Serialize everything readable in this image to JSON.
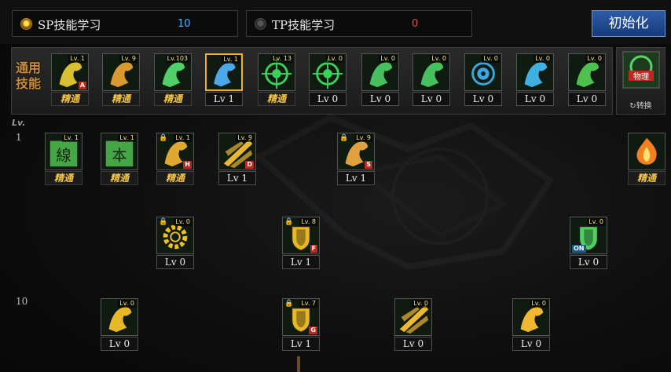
{
  "tabs": {
    "sp": {
      "label": "SP技能学习",
      "value": "10",
      "selected": true
    },
    "tp": {
      "label": "TP技能学习",
      "value": "0",
      "selected": false
    }
  },
  "init_button": "初始化",
  "common": {
    "label": "通用技能",
    "convert_label": "转换",
    "convert_icon_text": "物理",
    "skills": [
      {
        "name": "common-skill-1",
        "icon": "dash-kick-icon",
        "tag": "Lv. 1",
        "hotkey": "A",
        "badge": "精通",
        "badge_type": "master",
        "color": "#d8c030"
      },
      {
        "name": "common-skill-2",
        "icon": "fist-icon",
        "tag": "Lv. 9",
        "hotkey": "",
        "badge": "精通",
        "badge_type": "master",
        "color": "#d89a30"
      },
      {
        "name": "common-skill-3",
        "icon": "leap-icon",
        "tag": "Lv.103",
        "hotkey": "",
        "badge": "精通",
        "badge_type": "master",
        "color": "#4fd06a"
      },
      {
        "name": "common-skill-4",
        "icon": "wings-icon",
        "tag": "Lv. 1",
        "hotkey": "",
        "badge": "Lv 1",
        "badge_type": "lv",
        "color": "#4aa8e8",
        "selected": true
      },
      {
        "name": "common-skill-5",
        "icon": "target-icon",
        "tag": "Lv. 13",
        "hotkey": "",
        "badge": "精通",
        "badge_type": "master",
        "color": "#3ad05a"
      },
      {
        "name": "common-skill-6",
        "icon": "target-icon",
        "tag": "Lv. 0",
        "hotkey": "",
        "badge": "Lv 0",
        "badge_type": "lv",
        "color": "#3ad05a"
      },
      {
        "name": "common-skill-7",
        "icon": "runner-icon",
        "tag": "Lv. 0",
        "hotkey": "",
        "badge": "Lv 0",
        "badge_type": "lv",
        "color": "#49c060"
      },
      {
        "name": "common-skill-8",
        "icon": "runner-icon",
        "tag": "Lv. 0",
        "hotkey": "",
        "badge": "Lv 0",
        "badge_type": "lv",
        "color": "#49c060"
      },
      {
        "name": "common-skill-9",
        "icon": "eye-icon",
        "tag": "Lv. 0",
        "hotkey": "",
        "badge": "Lv 0",
        "badge_type": "lv",
        "color": "#3aa8e0"
      },
      {
        "name": "common-skill-10",
        "icon": "figure-icon",
        "tag": "Lv. 0",
        "hotkey": "",
        "badge": "Lv 0",
        "badge_type": "lv",
        "color": "#40b0e0"
      },
      {
        "name": "common-skill-11",
        "icon": "claw-icon",
        "tag": "Lv. 0",
        "hotkey": "",
        "badge": "Lv 0",
        "badge_type": "lv",
        "color": "#4ec050"
      }
    ]
  },
  "tree": {
    "lv_header": "Lv.",
    "row_labels": [
      "1",
      "10"
    ],
    "skills": [
      {
        "name": "tree-skill-line",
        "icon": "line-scroll-icon",
        "tag": "Lv. 1",
        "lock": "",
        "hotkey": "",
        "badge": "精通",
        "badge_type": "master",
        "color": "#50c050",
        "glyph": "線"
      },
      {
        "name": "tree-skill-base",
        "icon": "base-scroll-icon",
        "tag": "Lv. 1",
        "lock": "",
        "hotkey": "",
        "badge": "精通",
        "badge_type": "master",
        "color": "#50c050",
        "glyph": "本"
      },
      {
        "name": "tree-skill-swing",
        "icon": "swing-icon",
        "tag": "Lv. 1",
        "lock": "🔒",
        "hotkey": "H",
        "badge": "精通",
        "badge_type": "master",
        "color": "#e0a830"
      },
      {
        "name": "tree-skill-slash",
        "icon": "slash-icon",
        "tag": "Lv. 9",
        "lock": "",
        "hotkey": "D",
        "badge": "Lv 1",
        "badge_type": "lv",
        "color": "#e8b830"
      },
      {
        "name": "tree-skill-kick",
        "icon": "kick-icon",
        "tag": "Lv. 9",
        "lock": "🔒",
        "hotkey": "S",
        "badge": "Lv 1",
        "badge_type": "lv",
        "color": "#e0a040"
      },
      {
        "name": "tree-skill-flame",
        "icon": "flame-icon",
        "tag": "",
        "lock": "",
        "hotkey": "",
        "badge": "精通",
        "badge_type": "master",
        "color": "#f08020"
      },
      {
        "name": "tree-skill-gear",
        "icon": "gear-icon",
        "tag": "Lv. 0",
        "lock": "🔒",
        "hotkey": "",
        "badge": "Lv 0",
        "badge_type": "lv",
        "color": "#f0c020"
      },
      {
        "name": "tree-skill-shield-strike",
        "icon": "shield-strike-icon",
        "tag": "Lv. 8",
        "lock": "🔒",
        "hotkey": "F",
        "badge": "Lv 1",
        "badge_type": "lv",
        "color": "#e8b828"
      },
      {
        "name": "tree-skill-barrier",
        "icon": "barrier-icon",
        "tag": "Lv. 0",
        "lock": "",
        "hotkey": "",
        "badge": "Lv 0",
        "badge_type": "lv",
        "color": "#50d060",
        "on_tag": "ON"
      },
      {
        "name": "tree-skill-wing-burst",
        "icon": "wing-burst-icon",
        "tag": "Lv. 0",
        "lock": "",
        "hotkey": "",
        "badge": "Lv 0",
        "badge_type": "lv",
        "color": "#e8b828"
      },
      {
        "name": "tree-skill-guard",
        "icon": "guard-icon",
        "tag": "Lv. 7",
        "lock": "🔒",
        "hotkey": "G",
        "badge": "Lv 1",
        "badge_type": "lv",
        "color": "#e8b828"
      },
      {
        "name": "tree-skill-rush",
        "icon": "rush-icon",
        "tag": "Lv. 0",
        "lock": "",
        "hotkey": "",
        "badge": "Lv 0",
        "badge_type": "lv",
        "color": "#f0b830"
      },
      {
        "name": "tree-skill-smash",
        "icon": "smash-icon",
        "tag": "Lv. 0",
        "lock": "",
        "hotkey": "",
        "badge": "Lv 0",
        "badge_type": "lv",
        "color": "#f0b830"
      }
    ]
  }
}
